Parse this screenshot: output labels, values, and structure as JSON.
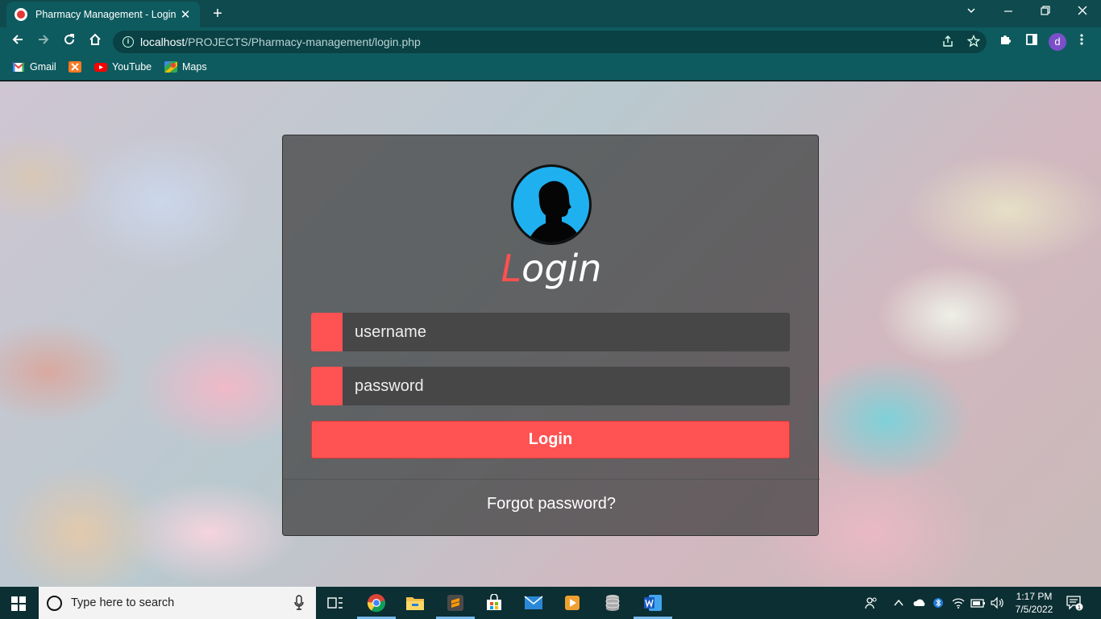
{
  "browser": {
    "tab_title": "Pharmacy Management - Login",
    "tab_close": "✕",
    "new_tab": "+",
    "url_host": "localhost",
    "url_path": "/PROJECTS/Pharmacy-management/login.php",
    "profile_initial": "d",
    "bookmarks": [
      {
        "label": "Gmail",
        "icon": "gmail-icon"
      },
      {
        "label": "",
        "icon": "xampp-icon"
      },
      {
        "label": "YouTube",
        "icon": "youtube-icon"
      },
      {
        "label": "Maps",
        "icon": "maps-icon"
      }
    ]
  },
  "login": {
    "title_first_letter": "L",
    "title_rest": "ogin",
    "username_placeholder": "username",
    "password_placeholder": "password",
    "button_label": "Login",
    "forgot_label": "Forgot password?"
  },
  "taskbar": {
    "search_placeholder": "Type here to search",
    "time": "1:17 PM",
    "date": "7/5/2022",
    "notification_count": "1"
  },
  "colors": {
    "accent": "#ff5252",
    "chrome": "#0e5b5f"
  }
}
